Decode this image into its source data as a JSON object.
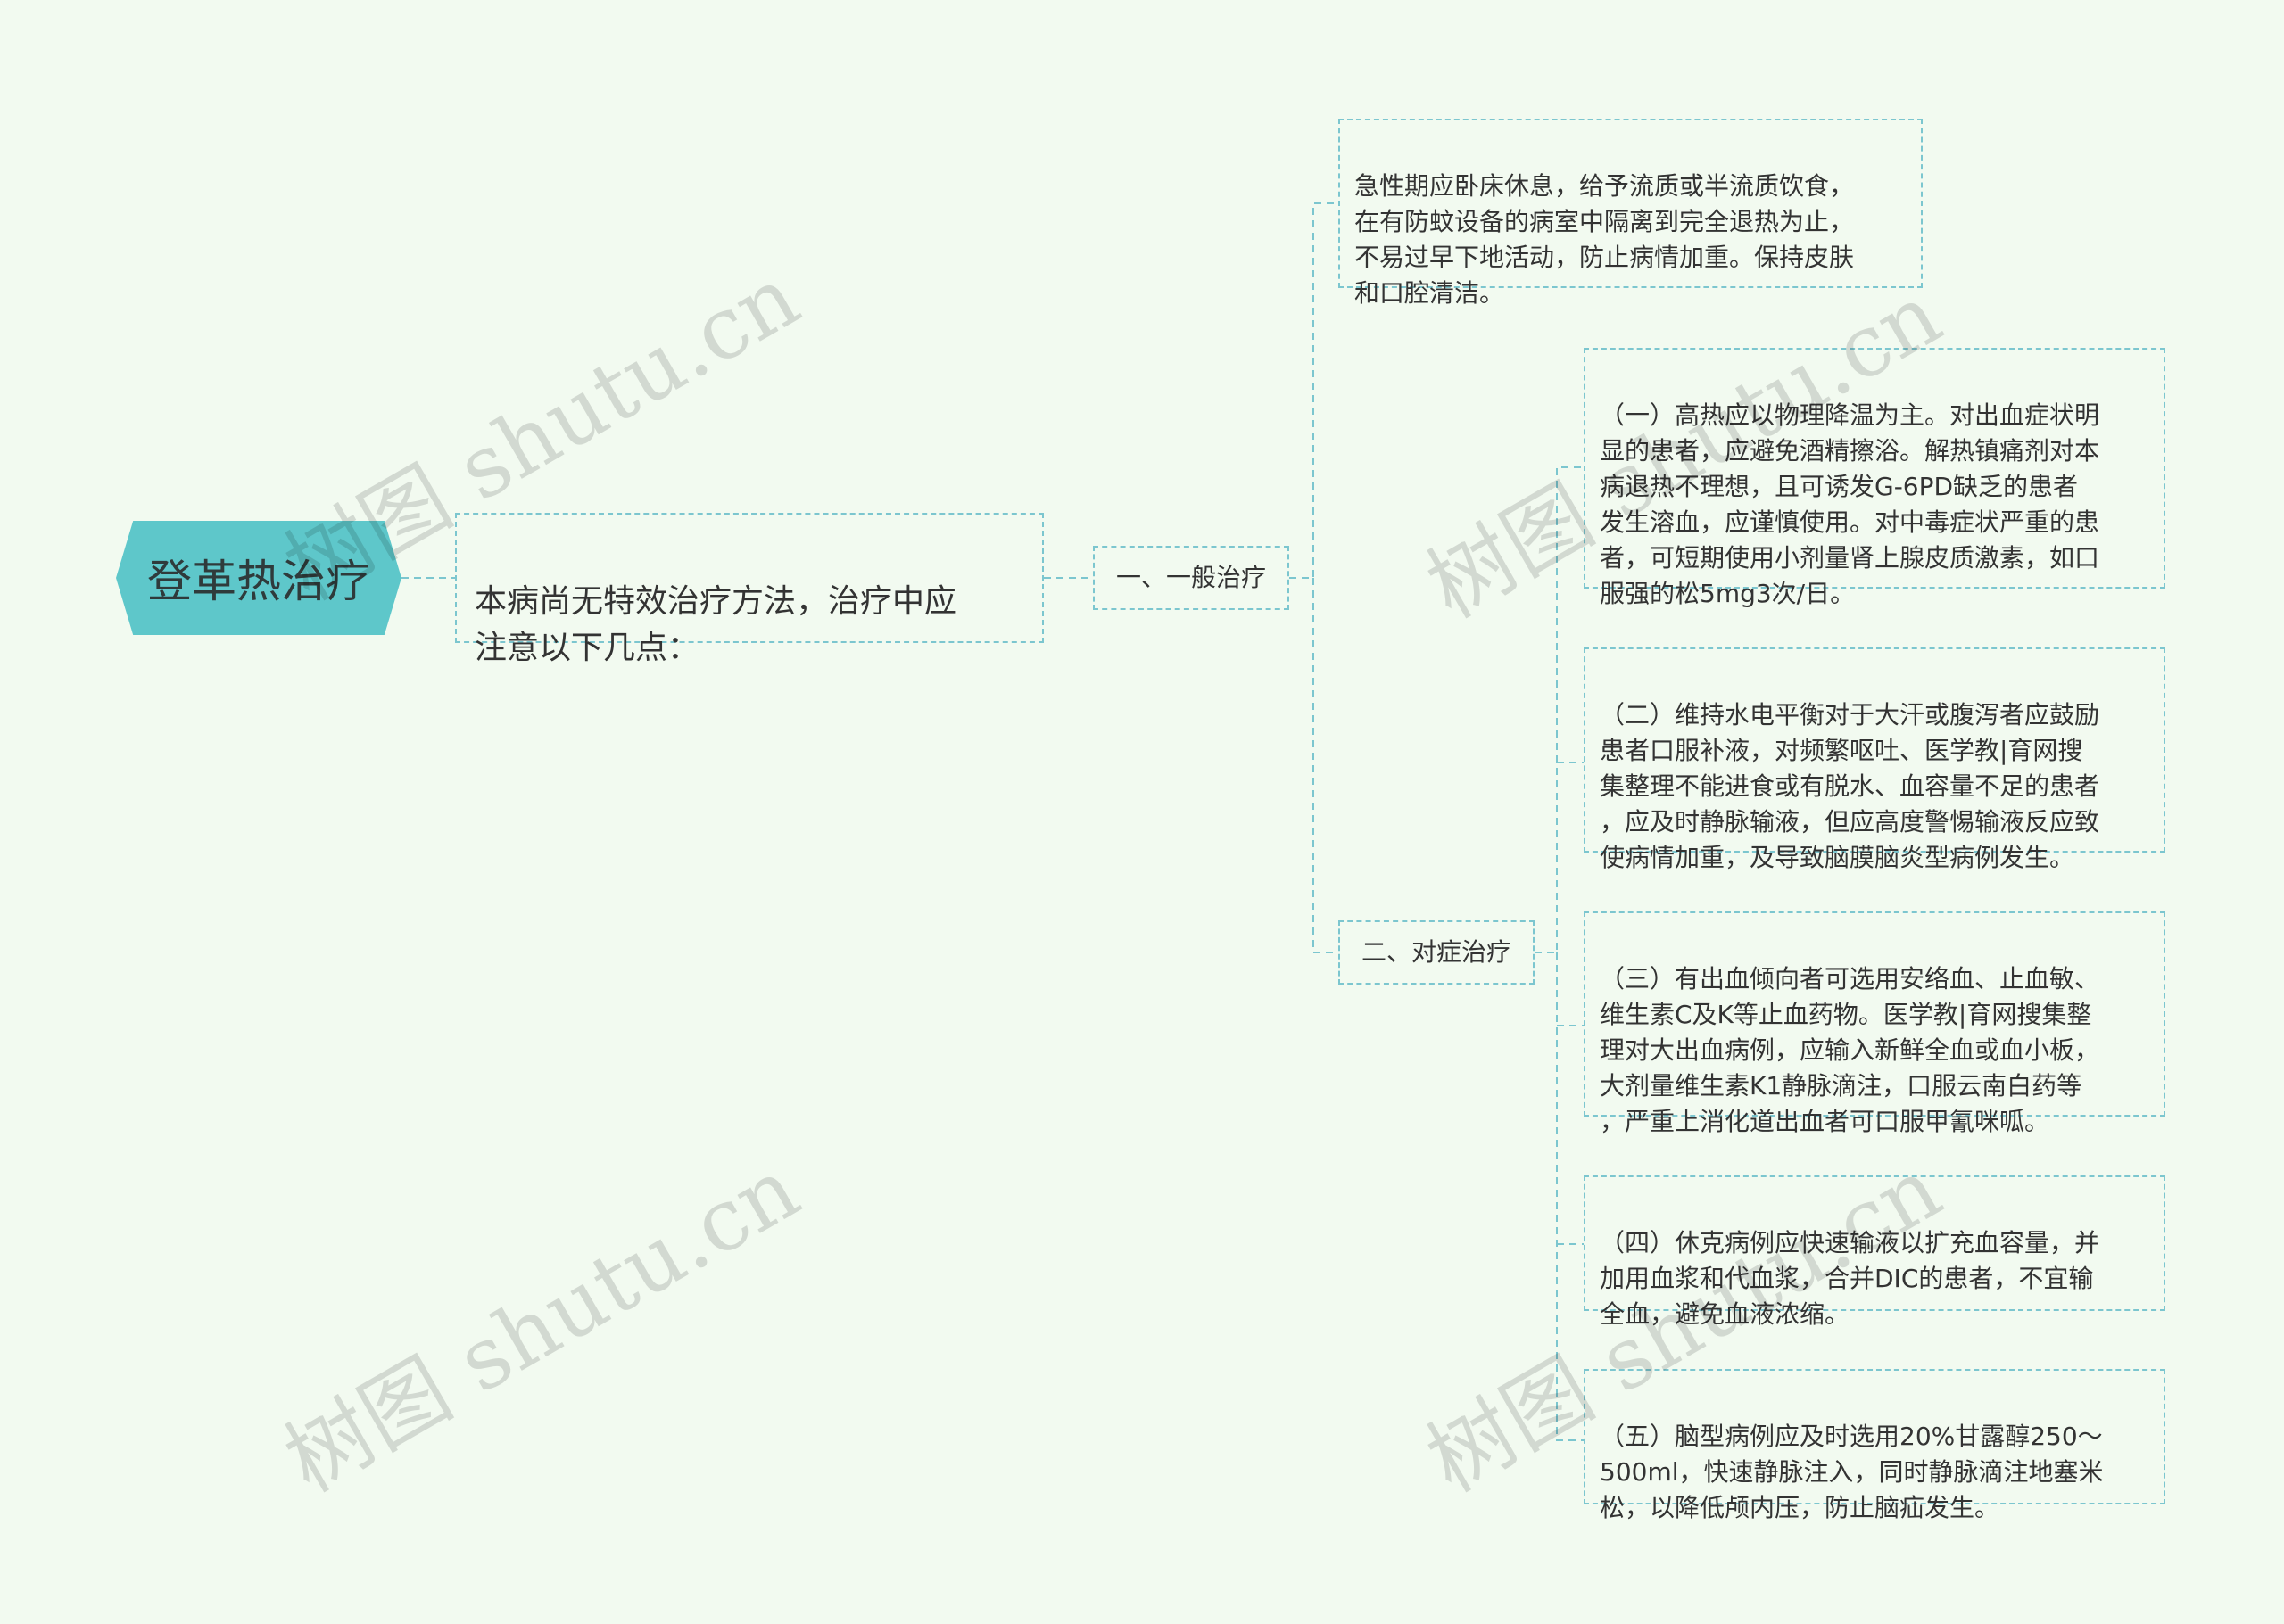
{
  "root": {
    "title": "登革热治疗"
  },
  "intro": {
    "text": "本病尚无特效治疗方法，治疗中应\n注意以下几点："
  },
  "branches": {
    "general": {
      "label": "一、一般治疗",
      "items": [
        "急性期应卧床休息，给予流质或半流质饮食，\n在有防蚊设备的病室中隔离到完全退热为止，\n不易过早下地活动，防止病情加重。保持皮肤\n和口腔清洁。"
      ]
    },
    "symptomatic": {
      "label": "二、对症治疗",
      "items": [
        "（一）高热应以物理降温为主。对出血症状明\n显的患者，应避免酒精擦浴。解热镇痛剂对本\n病退热不理想，且可诱发G-6PD缺乏的患者\n发生溶血，应谨慎使用。对中毒症状严重的患\n者，可短期使用小剂量肾上腺皮质激素，如口\n服强的松5mg3次/日。",
        "（二）维持水电平衡对于大汗或腹泻者应鼓励\n患者口服补液，对频繁呕吐、医学教|育网搜\n集整理不能进食或有脱水、血容量不足的患者\n，应及时静脉输液，但应高度警惕输液反应致\n使病情加重，及导致脑膜脑炎型病例发生。",
        "（三）有出血倾向者可选用安络血、止血敏、\n维生素C及K等止血药物。医学教|育网搜集整\n理对大出血病例，应输入新鲜全血或血小板，\n大剂量维生素K1静脉滴注，口服云南白药等\n，严重上消化道出血者可口服甲氰咪呱。",
        "（四）休克病例应快速输液以扩充血容量，并\n加用血浆和代血浆，合并DIC的患者，不宜输\n全血，避免血液浓缩。",
        "（五）脑型病例应及时选用20%甘露醇250～\n500ml，快速静脉注入，同时静脉滴注地塞米\n松，以降低颅内压，防止脑疝发生。"
      ]
    }
  },
  "watermark": {
    "text": "树图 shutu.cn"
  },
  "colors": {
    "background": "#f2faf0",
    "root_fill": "#5ec7ca",
    "border": "#7cc6cf"
  }
}
